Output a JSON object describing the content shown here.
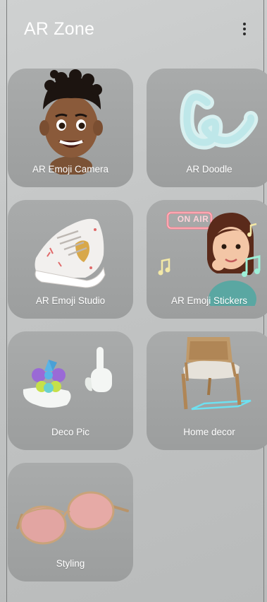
{
  "header": {
    "title": "AR Zone",
    "menu_icon": "more-vertical-icon"
  },
  "features": [
    {
      "label": "AR Emoji Camera",
      "icon": "avatar-head-icon"
    },
    {
      "label": "AR Doodle",
      "icon": "doodle-squiggle-icon"
    },
    {
      "label": "AR Emoji Studio",
      "icon": "sneaker-icon"
    },
    {
      "label": "AR Emoji Stickers",
      "icon": "sticker-avatar-icon",
      "badge": "ON AIR"
    },
    {
      "label": "Deco Pic",
      "icon": "deco-hands-icon"
    },
    {
      "label": "Home decor",
      "icon": "chair-icon"
    },
    {
      "label": "Styling",
      "icon": "sunglasses-icon"
    }
  ],
  "colors": {
    "card": "#a3a5a5",
    "label": "#ffffff",
    "background": "#c6c8c8"
  }
}
